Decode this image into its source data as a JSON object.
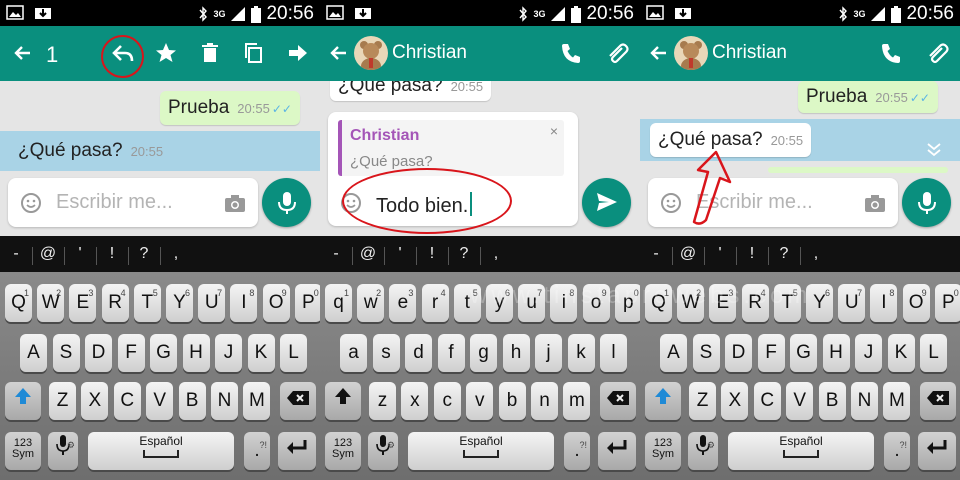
{
  "status": {
    "time": "20:56",
    "network": "3G"
  },
  "panels": [
    {
      "appbar": {
        "selected_count": "1"
      },
      "messages": {
        "outgoing": {
          "text": "Prueba",
          "time": "20:55"
        },
        "incoming": {
          "text": "¿Qué pasa?",
          "time": "20:55"
        }
      },
      "input": {
        "placeholder": "Escribir me..."
      }
    },
    {
      "appbar": {
        "contact_name": "Christian"
      },
      "messages": {
        "incoming_partial": {
          "text": "¿Qué pasa?",
          "time": "20:55"
        }
      },
      "reply_preview": {
        "name": "Christian",
        "text": "¿Qué pasa?",
        "close": "×"
      },
      "input": {
        "value": "Todo bien."
      }
    },
    {
      "appbar": {
        "contact_name": "Christian"
      },
      "messages": {
        "outgoing": {
          "text": "Prueba",
          "time": "20:55"
        },
        "incoming": {
          "text": "¿Qué pasa?",
          "time": "20:55"
        }
      },
      "input": {
        "placeholder": "Escribir me..."
      }
    }
  ],
  "symbols": [
    "-",
    "@",
    "'",
    "!",
    "?",
    ","
  ],
  "keyboard": {
    "upper_row1": [
      "Q",
      "W",
      "E",
      "R",
      "T",
      "Y",
      "U",
      "I",
      "O",
      "P"
    ],
    "lower_row1": [
      "q",
      "w",
      "e",
      "r",
      "t",
      "y",
      "u",
      "i",
      "o",
      "p"
    ],
    "row1_numbers": [
      "1",
      "2",
      "3",
      "4",
      "5",
      "6",
      "7",
      "8",
      "9",
      "0"
    ],
    "upper_row2": [
      "A",
      "S",
      "D",
      "F",
      "G",
      "H",
      "J",
      "K",
      "L"
    ],
    "lower_row2": [
      "a",
      "s",
      "d",
      "f",
      "g",
      "h",
      "j",
      "k",
      "l"
    ],
    "upper_row3": [
      "Z",
      "X",
      "C",
      "V",
      "B",
      "N",
      "M"
    ],
    "lower_row3": [
      "z",
      "x",
      "c",
      "v",
      "b",
      "n",
      "m"
    ],
    "sym_key": [
      "123",
      "Sym"
    ],
    "space_label": "Español",
    "period": ".",
    "period_sub": "?!",
    "mic_sub": "⚙"
  },
  "watermark": "www.tinstaprowebs.com",
  "colors": {
    "appbar": "#0a8f7e",
    "outgoing_bubble": "#dcf8c6",
    "selection": "#a9d3e6",
    "annotation": "#d9151b",
    "quote_accent": "#a455b7"
  }
}
